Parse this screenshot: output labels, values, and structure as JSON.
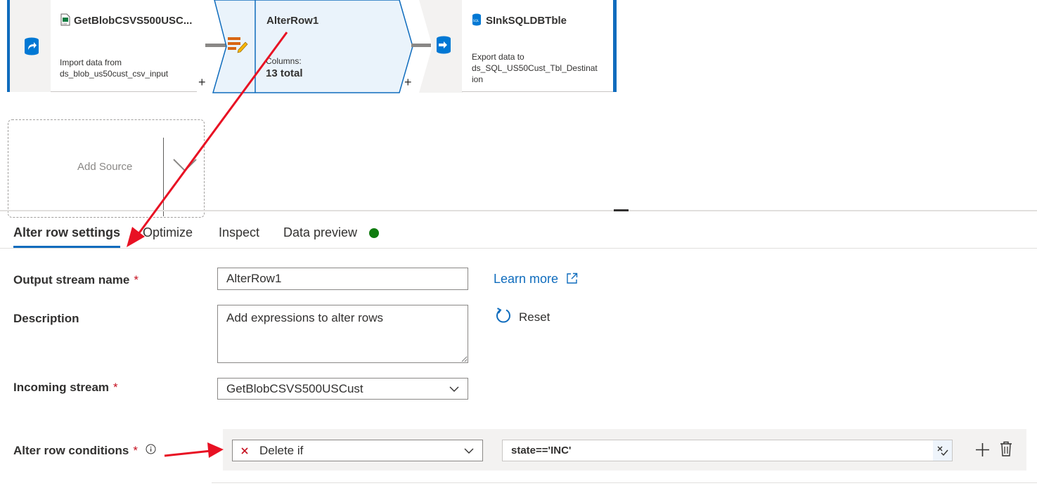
{
  "flow": {
    "source_node": {
      "title": "GetBlobCSVS500USC...",
      "desc_line1": "Import data from",
      "desc_line2": "ds_blob_us50cust_csv_input",
      "plus": "+",
      "icon": "blob-source-icon",
      "title_icon": "csv-file-icon"
    },
    "alter_node": {
      "title": "AlterRow1",
      "columns_label": "Columns:",
      "columns_value": "13 total",
      "plus": "+",
      "icon": "alter-row-icon"
    },
    "sink_node": {
      "title": "SInkSQLDBTble",
      "desc_line1": "Export data to",
      "desc_line2": "ds_SQL_US50Cust_Tbl_Destinat",
      "desc_line3": "ion",
      "icon": "sink-database-icon",
      "title_icon": "sql-icon"
    },
    "add_source": {
      "label": "Add Source"
    }
  },
  "tabs": [
    {
      "label": "Alter row settings",
      "active": true
    },
    {
      "label": "Optimize"
    },
    {
      "label": "Inspect"
    },
    {
      "label": "Data preview",
      "status_color": "#107c10"
    }
  ],
  "form": {
    "output_stream": {
      "label": "Output stream name",
      "required": "*",
      "value": "AlterRow1"
    },
    "description": {
      "label": "Description",
      "value": "Add expressions to alter rows"
    },
    "incoming_stream": {
      "label": "Incoming stream",
      "required": "*",
      "value": "GetBlobCSVS500USCust"
    },
    "learn_more": "Learn more",
    "reset": "Reset",
    "conditions": {
      "label": "Alter row conditions",
      "required": "*",
      "type_value": "Delete if",
      "expression": "state=='INC'"
    }
  },
  "colors": {
    "accent": "#0f6cbd",
    "annotation_arrow": "#e81123",
    "node_border": "#0f6cbd",
    "required": "#c50f1f"
  }
}
